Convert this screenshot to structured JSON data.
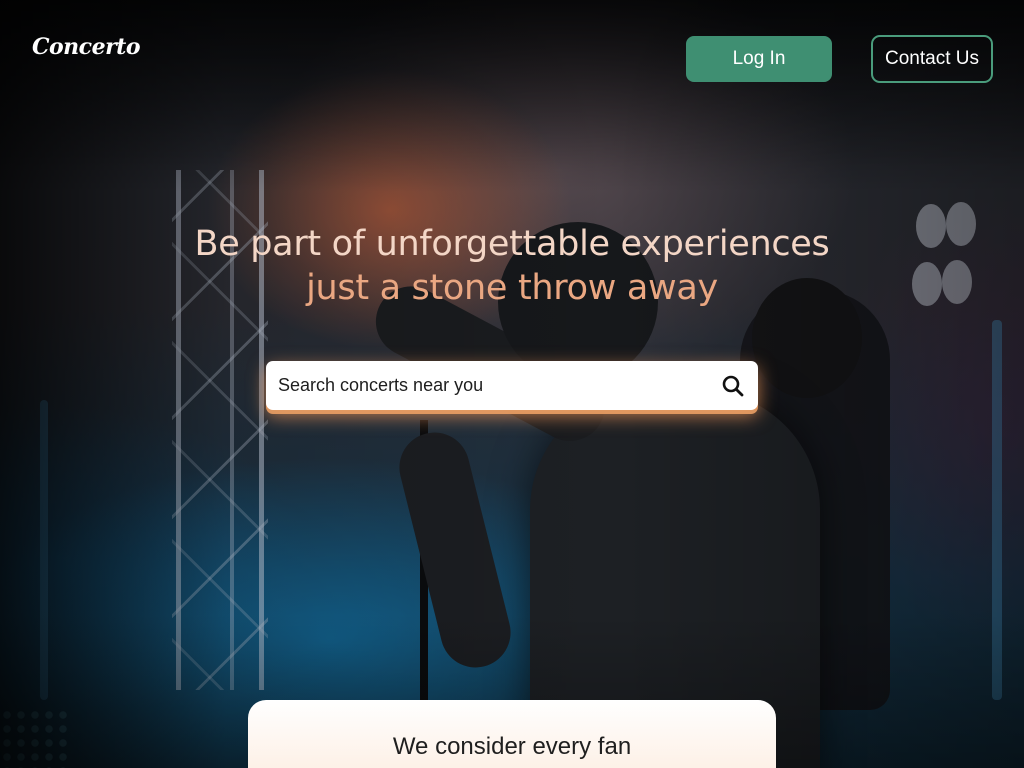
{
  "header": {
    "logo_text": "Concerto",
    "login_label": "Log In",
    "contact_label": "Contact Us"
  },
  "hero": {
    "headline_line1": "Be part of unforgettable experiences",
    "headline_line2": "just a stone throw away"
  },
  "search": {
    "placeholder": "Search concerts near you",
    "value": "",
    "icon": "search-icon"
  },
  "card": {
    "title": "We consider every fan"
  },
  "colors": {
    "accent_green": "#3f8f72",
    "headline_light": "#f3d6c6",
    "headline_orange": "#eaa782",
    "search_glow": "#ea9e64"
  }
}
